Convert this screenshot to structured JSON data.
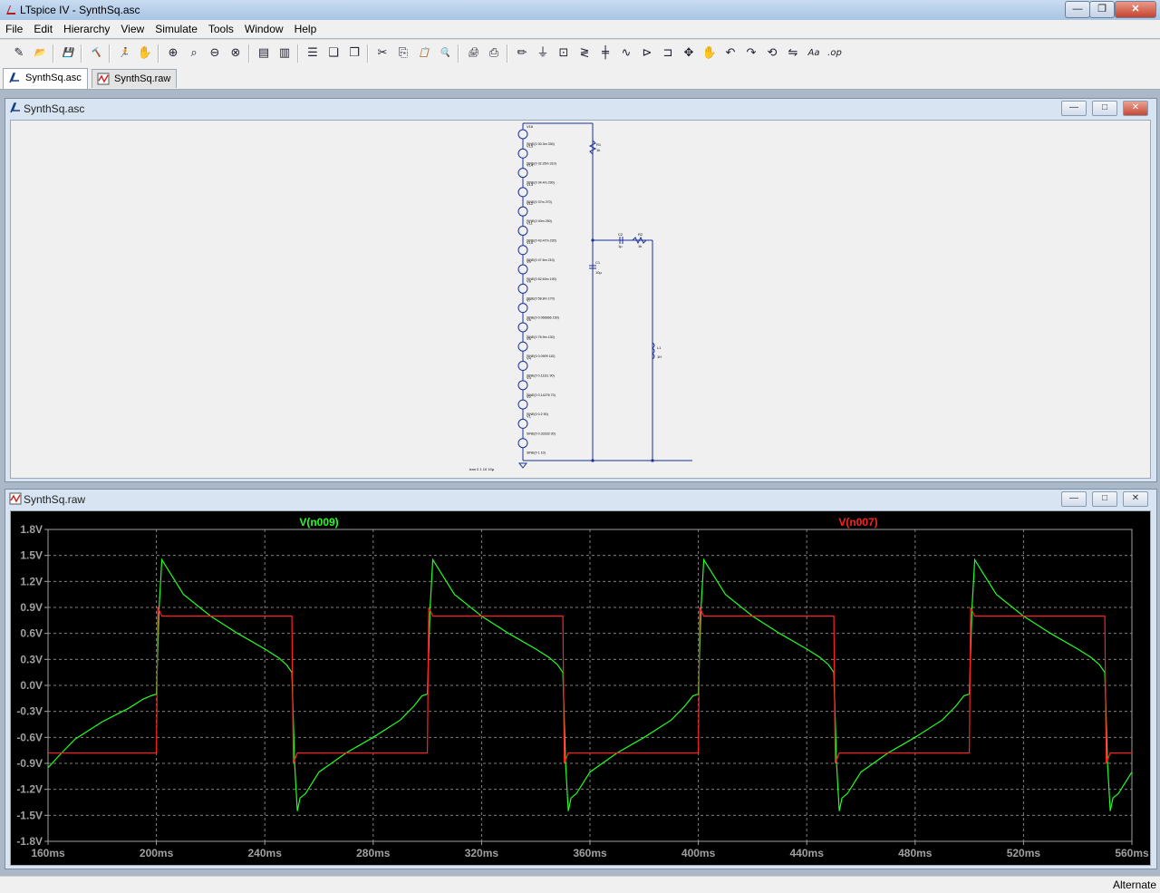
{
  "window": {
    "title": "LTspice IV - SynthSq.asc",
    "min": "—",
    "max": "❐",
    "close": "✕"
  },
  "menu": [
    "File",
    "Edit",
    "Hierarchy",
    "View",
    "Simulate",
    "Tools",
    "Window",
    "Help"
  ],
  "toolbar": [
    {
      "name": "new-schematic-icon",
      "glyph": "✎"
    },
    {
      "name": "open-icon",
      "glyph": "📂"
    },
    {
      "sep": true
    },
    {
      "name": "save-icon",
      "glyph": "💾"
    },
    {
      "sep": true
    },
    {
      "name": "control-panel-icon",
      "glyph": "🔨"
    },
    {
      "sep": true
    },
    {
      "name": "run-icon",
      "glyph": "🏃"
    },
    {
      "name": "halt-icon",
      "glyph": "✋"
    },
    {
      "sep": true
    },
    {
      "name": "zoom-in-icon",
      "glyph": "⊕"
    },
    {
      "name": "pan-icon",
      "glyph": "⌕"
    },
    {
      "name": "zoom-out-icon",
      "glyph": "⊖"
    },
    {
      "name": "zoom-full-icon",
      "glyph": "⊗"
    },
    {
      "sep": true
    },
    {
      "name": "autorange-icon",
      "glyph": "▤"
    },
    {
      "name": "delete-traces-icon",
      "glyph": "▥"
    },
    {
      "sep": true
    },
    {
      "name": "tile-horizontal-icon",
      "glyph": "☰"
    },
    {
      "name": "cascade-icon",
      "glyph": "❏"
    },
    {
      "name": "tile-vertical-icon",
      "glyph": "❐"
    },
    {
      "sep": true
    },
    {
      "name": "cut-icon",
      "glyph": "✂"
    },
    {
      "name": "copy-icon",
      "glyph": "⎘"
    },
    {
      "name": "paste-icon",
      "glyph": "📋"
    },
    {
      "name": "find-icon",
      "glyph": "🔍"
    },
    {
      "sep": true
    },
    {
      "name": "print-setup-icon",
      "glyph": "🖨"
    },
    {
      "name": "print-icon",
      "glyph": "⎙"
    },
    {
      "sep": true
    },
    {
      "name": "draw-wire-icon",
      "glyph": "✏"
    },
    {
      "name": "ground-icon",
      "glyph": "⏚"
    },
    {
      "name": "label-net-icon",
      "glyph": "⊡"
    },
    {
      "name": "resistor-icon",
      "glyph": "≷"
    },
    {
      "name": "capacitor-icon",
      "glyph": "╪"
    },
    {
      "name": "inductor-icon",
      "glyph": "∿"
    },
    {
      "name": "diode-icon",
      "glyph": "⊳"
    },
    {
      "name": "component-icon",
      "glyph": "⊐"
    },
    {
      "name": "move-icon",
      "glyph": "✥"
    },
    {
      "name": "drag-icon",
      "glyph": "✋"
    },
    {
      "name": "undo-icon",
      "glyph": "↶"
    },
    {
      "name": "redo-icon",
      "glyph": "↷"
    },
    {
      "name": "rotate-icon",
      "glyph": "⟲"
    },
    {
      "name": "mirror-icon",
      "glyph": "⇋"
    },
    {
      "name": "text-icon",
      "glyph": "Aa"
    },
    {
      "name": "spice-directive-icon",
      "glyph": ".op"
    }
  ],
  "tabs": [
    {
      "label": "SynthSq.asc",
      "active": true
    },
    {
      "label": "SynthSq.raw",
      "active": false
    }
  ],
  "schematic_window": {
    "title": "SynthSq.asc"
  },
  "waveform_window": {
    "title": "SynthSq.raw"
  },
  "mdi_controls": {
    "min": "—",
    "max": "□",
    "close": "✕"
  },
  "schematic": {
    "sources": [
      {
        "ref": "V16",
        "value": "SINE(0 30.3m 330)"
      },
      {
        "ref": "V15",
        "value": "SINE(0 32.26m 310)"
      },
      {
        "ref": "V14",
        "value": "SINE(0 34.4m 290)"
      },
      {
        "ref": "V13",
        "value": "SINE(0 37m 270)"
      },
      {
        "ref": "V12",
        "value": "SINE(0 40m 250)"
      },
      {
        "ref": "V11",
        "value": "SINE(0 43.47m 230)"
      },
      {
        "ref": "V10",
        "value": "SINE(0 47.6m 210)"
      },
      {
        "ref": "V9",
        "value": "SINE(0 52.63m 190)"
      },
      {
        "ref": "V8",
        "value": "SINE(0 58.8m 170)"
      },
      {
        "ref": "V7",
        "value": "SINE(0 0.066666 150)"
      },
      {
        "ref": "V6",
        "value": "SINE(0 76.9m 130)"
      },
      {
        "ref": "V5",
        "value": "SINE(0 0.0909 110)"
      },
      {
        "ref": "V4",
        "value": "SINE(0 0.11111 90)"
      },
      {
        "ref": "V3",
        "value": "SINE(0 0.14276 70)"
      },
      {
        "ref": "V2",
        "value": "SINE(0 0.2 50)"
      },
      {
        "ref": "V1",
        "value": "SINE(0 0.33333 30)"
      },
      {
        "ref": "",
        "value": "SINE(0 1 10)"
      }
    ],
    "r1": {
      "ref": "R1",
      "value": "1k"
    },
    "c1": {
      "ref": "C1",
      "value": "10µ"
    },
    "c2": {
      "ref": "C2",
      "value": "1µ"
    },
    "r2": {
      "ref": "R2",
      "value": "1k"
    },
    "l1": {
      "ref": "L1",
      "value": "1H"
    },
    "directive": ".tran 0 1 10 10µ"
  },
  "chart_data": {
    "type": "line",
    "title": "",
    "xlabel": "",
    "ylabel": "",
    "xlim": [
      160,
      560
    ],
    "ylim": [
      -1.8,
      1.8
    ],
    "x_ticks": [
      "160ms",
      "200ms",
      "240ms",
      "280ms",
      "320ms",
      "360ms",
      "400ms",
      "440ms",
      "480ms",
      "520ms",
      "560ms"
    ],
    "y_ticks": [
      "1.8V",
      "1.5V",
      "1.2V",
      "0.9V",
      "0.6V",
      "0.3V",
      "0.0V",
      "-0.3V",
      "-0.6V",
      "-0.9V",
      "-1.2V",
      "-1.5V",
      "-1.8V"
    ],
    "grid": true,
    "background": "#000000",
    "series": [
      {
        "name": "V(n009)",
        "color": "#22ff22",
        "description_shape": "square-wave-synthesis-ringing",
        "x": [
          160,
          165,
          170,
          180,
          190,
          195,
          198,
          200,
          201,
          202,
          205,
          210,
          220,
          230,
          240,
          245,
          248,
          250,
          251,
          252,
          253,
          255,
          260,
          270,
          280,
          290,
          295,
          298,
          300,
          301,
          302,
          305,
          310,
          320,
          330,
          340,
          345,
          348,
          350,
          351,
          352,
          353,
          355,
          360,
          370,
          380,
          390,
          395,
          398,
          400,
          401,
          402,
          405,
          410,
          420,
          430,
          440,
          445,
          448,
          450,
          451,
          452,
          453,
          455,
          460,
          470,
          480,
          490,
          495,
          498,
          500,
          501,
          502,
          505,
          510,
          520,
          530,
          540,
          545,
          548,
          550,
          551,
          552,
          553,
          555,
          560
        ],
        "y": [
          -0.95,
          -0.78,
          -0.62,
          -0.42,
          -0.26,
          -0.16,
          -0.12,
          -0.1,
          0.9,
          1.45,
          1.3,
          1.05,
          0.8,
          0.6,
          0.42,
          0.32,
          0.24,
          0.15,
          -0.9,
          -1.45,
          -1.3,
          -1.25,
          -1.0,
          -0.78,
          -0.6,
          -0.4,
          -0.24,
          -0.12,
          -0.1,
          0.9,
          1.45,
          1.3,
          1.05,
          0.8,
          0.6,
          0.42,
          0.32,
          0.24,
          0.15,
          -0.9,
          -1.45,
          -1.3,
          -1.25,
          -1.0,
          -0.78,
          -0.6,
          -0.4,
          -0.24,
          -0.12,
          -0.1,
          0.9,
          1.45,
          1.3,
          1.05,
          0.8,
          0.6,
          0.42,
          0.32,
          0.24,
          0.15,
          -0.9,
          -1.45,
          -1.3,
          -1.25,
          -1.0,
          -0.78,
          -0.6,
          -0.4,
          -0.24,
          -0.12,
          -0.1,
          0.9,
          1.45,
          1.3,
          1.05,
          0.8,
          0.6,
          0.42,
          0.32,
          0.24,
          0.15,
          -0.9,
          -1.45,
          -1.3,
          -1.25,
          -1.0
        ]
      },
      {
        "name": "V(n007)",
        "color": "#ff2020",
        "x": [
          160,
          200,
          200.5,
          202,
          250,
          250.5,
          252,
          300,
          300.5,
          302,
          350,
          350.5,
          352,
          400,
          400.5,
          402,
          450,
          450.5,
          452,
          500,
          500.5,
          502,
          550,
          550.5,
          552,
          560
        ],
        "y": [
          -0.78,
          -0.78,
          0.9,
          0.8,
          0.8,
          -0.9,
          -0.78,
          -0.78,
          0.9,
          0.8,
          0.8,
          -0.9,
          -0.78,
          -0.78,
          0.9,
          0.8,
          0.8,
          -0.9,
          -0.78,
          -0.78,
          0.9,
          0.8,
          0.8,
          -0.9,
          -0.78,
          -0.78
        ]
      }
    ],
    "legend": "top"
  },
  "status": {
    "text": "Alternate"
  }
}
